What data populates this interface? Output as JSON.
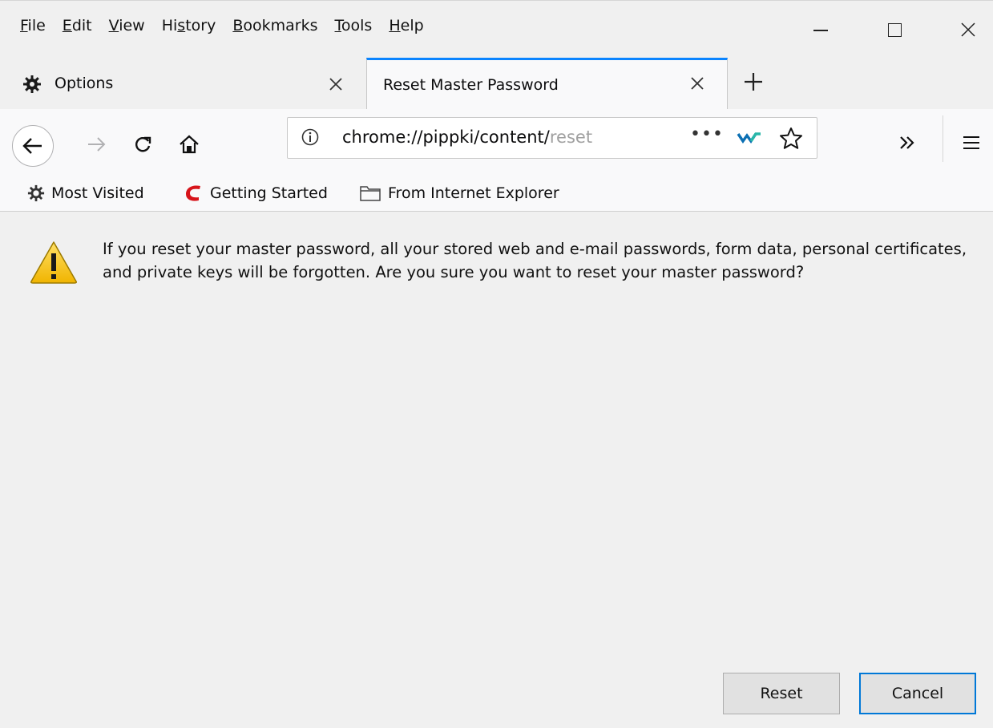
{
  "menubar": {
    "items": [
      {
        "prefix": "",
        "accel": "F",
        "rest": "ile"
      },
      {
        "prefix": "",
        "accel": "E",
        "rest": "dit"
      },
      {
        "prefix": "",
        "accel": "V",
        "rest": "iew"
      },
      {
        "prefix": "Hi",
        "accel": "s",
        "rest": "tory"
      },
      {
        "prefix": "",
        "accel": "B",
        "rest": "ookmarks"
      },
      {
        "prefix": "",
        "accel": "T",
        "rest": "ools"
      },
      {
        "prefix": "",
        "accel": "H",
        "rest": "elp"
      }
    ]
  },
  "tabs": [
    {
      "label": "Options",
      "icon": "gear-icon",
      "active": false
    },
    {
      "label": "Reset Master Password",
      "active": true
    }
  ],
  "urlbar": {
    "url_visible": "chrome://pippki/content/",
    "url_faded": "reset",
    "more_label": "•••"
  },
  "bookmarks": [
    {
      "label": "Most Visited",
      "icon": "gear-icon"
    },
    {
      "label": "Getting Started",
      "icon": "brand-c-icon"
    },
    {
      "label": "From Internet Explorer",
      "icon": "folder-icon"
    }
  ],
  "dialog": {
    "message": "If you reset your master password, all your stored web and e-mail passwords, form data, personal certificates, and private keys will be forgotten. Are you sure you want to reset your master password?",
    "reset_label": "Reset",
    "cancel_label": "Cancel"
  },
  "colors": {
    "accent": "#0a84ff",
    "focus_border": "#0078d7",
    "brand_red": "#d7141a",
    "warning_yellow": "#f5c400"
  }
}
